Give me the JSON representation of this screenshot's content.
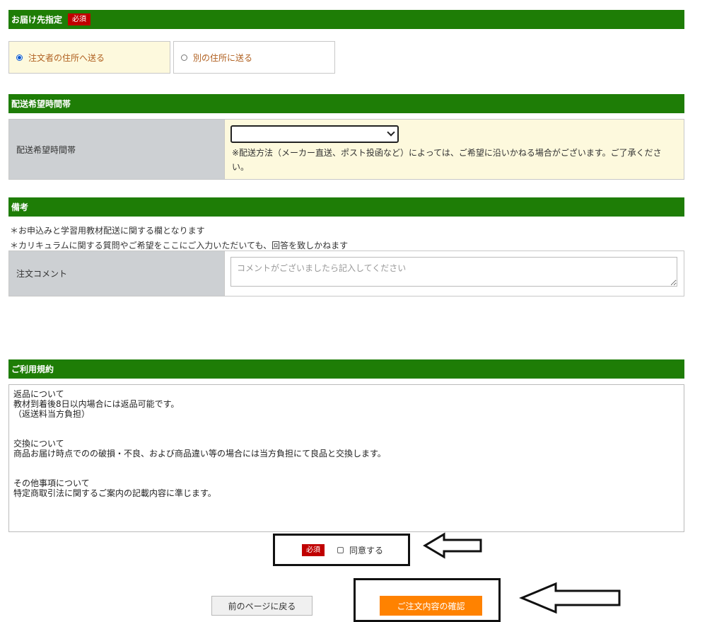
{
  "delivery": {
    "title": "お届け先指定",
    "required": "必須",
    "option_self": "注文者の住所へ送る",
    "option_other": "別の住所に送る"
  },
  "time": {
    "title": "配送希望時間帯",
    "label": "配送希望時間帯",
    "selected": "",
    "note": "※配送方法（メーカー直送、ポスト投函など）によっては、ご希望に沿いかねる場合がございます。ご了承ください。"
  },
  "remarks": {
    "title": "備考",
    "note1": "＊お申込みと学習用教材配送に関する欄となります",
    "note2": "＊カリキュラムに関する質問やご希望をここにご入力いただいても、回答を致しかねます",
    "label": "注文コメント",
    "placeholder": "コメントがございましたら記入してください"
  },
  "terms": {
    "title": "ご利用規約",
    "returns_heading": "返品について",
    "returns_line1": "教材到着後8日以内場合には返品可能です。",
    "returns_line2": "（返送料当方負担）",
    "exchange_heading": "交換について",
    "exchange_line1": "商品お届け時点でのの破損・不良、および商品違い等の場合には当方負担にて良品と交換します。",
    "other_heading": "その他事項について",
    "other_line1": "特定商取引法に関するご案内の記載内容に準じます。"
  },
  "agree": {
    "required": "必須",
    "label": "同意する"
  },
  "buttons": {
    "back": "前のページに戻る",
    "confirm": "ご注文内容の確認"
  },
  "colors": {
    "section_bar": "#1e7d06",
    "badge": "#c00000",
    "confirm": "#ff8200",
    "selected_bg": "#fdf9dd",
    "label_bg": "#cdd0d3"
  }
}
